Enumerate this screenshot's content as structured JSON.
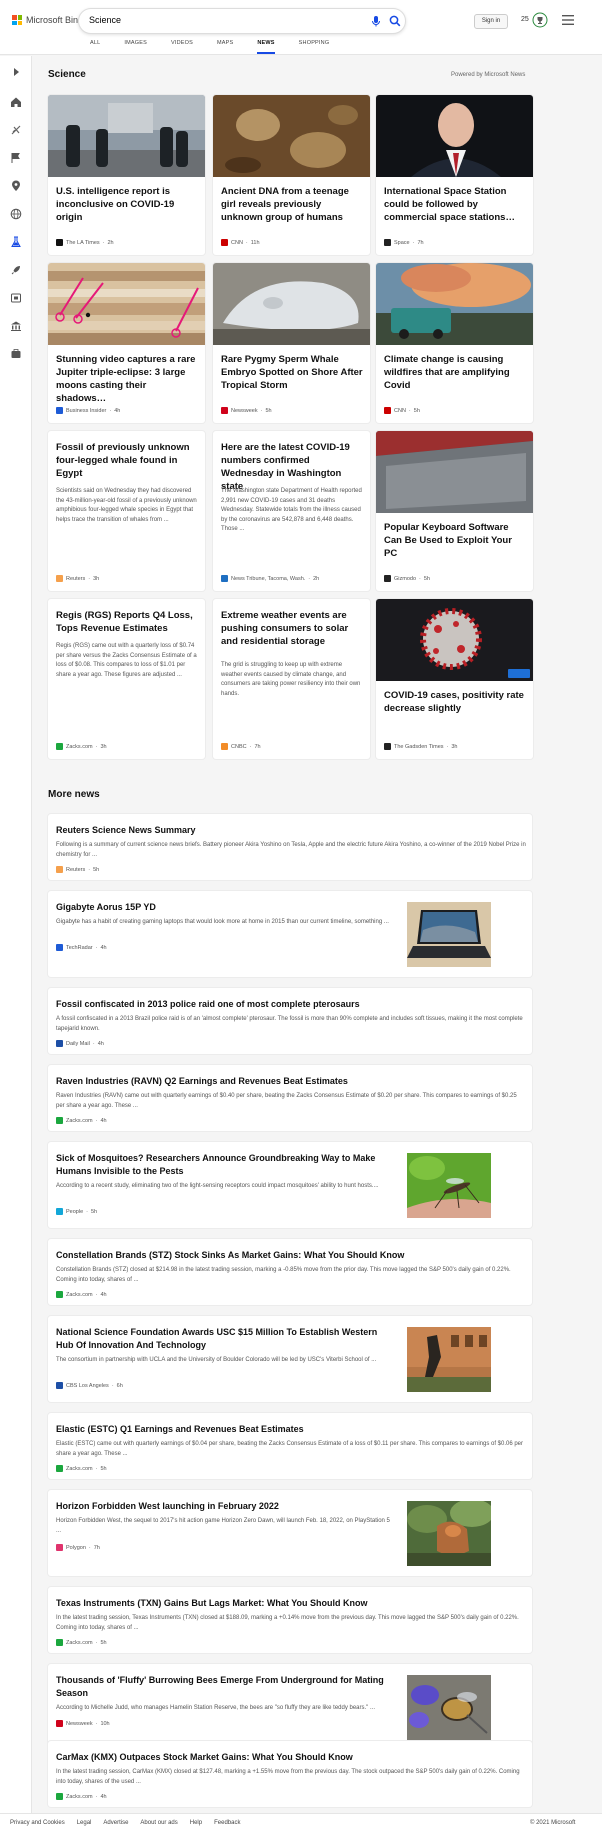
{
  "brand": {
    "name": "Microsoft Bing"
  },
  "search": {
    "value": "Science"
  },
  "header": {
    "signin_label": "Sign in",
    "rewards_count": "25"
  },
  "tabs": [
    {
      "label": "ALL"
    },
    {
      "label": "IMAGES"
    },
    {
      "label": "VIDEOS"
    },
    {
      "label": "MAPS"
    },
    {
      "label": "NEWS"
    },
    {
      "label": "SHOPPING"
    }
  ],
  "rail_icons": [
    "expand-icon",
    "home-icon",
    "sports-icon",
    "flag-icon",
    "location-icon",
    "globe-icon",
    "science-icon",
    "rocket-icon",
    "entertainment-icon",
    "money-icon",
    "health-icon"
  ],
  "section": {
    "title": "Science",
    "powered_by": "Powered by Microsoft News"
  },
  "cards": [
    {
      "title": "U.S. intelligence report is inconclusive on COVID-19 origin",
      "source": "The LA Times",
      "time": "2h",
      "snippet": ""
    },
    {
      "title": "Ancient DNA from a teenage girl reveals previously unknown group of humans",
      "source": "CNN",
      "time": "11h",
      "snippet": ""
    },
    {
      "title": "International Space Station could be followed by commercial space stations…",
      "source": "Space",
      "time": "7h",
      "snippet": ""
    },
    {
      "title": "Stunning video captures a rare Jupiter triple-eclipse: 3 large moons casting their shadows…",
      "source": "Business Insider",
      "time": "4h",
      "snippet": ""
    },
    {
      "title": "Rare Pygmy Sperm Whale Embryo Spotted on Shore After Tropical Storm",
      "source": "Newsweek",
      "time": "5h",
      "snippet": ""
    },
    {
      "title": "Climate change is causing wildfires that are amplifying Covid",
      "source": "CNN",
      "time": "5h",
      "snippet": ""
    },
    {
      "title": "Fossil of previously unknown four-legged whale found in Egypt",
      "source": "Reuters",
      "time": "3h",
      "snippet": "Scientists said on Wednesday they had discovered the 43-million-year-old fossil of a previously unknown amphibious four-legged whale species in Egypt that helps trace the transition of whales from ..."
    },
    {
      "title": "Here are the latest COVID-19 numbers confirmed Wednesday in Washington state",
      "source": "News Tribune, Tacoma, Wash.",
      "time": "2h",
      "snippet": "The Washington state Department of Health reported 2,991 new COVID-19 cases and 31 deaths Wednesday. Statewide totals from the illness caused by the coronavirus are 542,878 and 6,448 deaths. Those ..."
    },
    {
      "title": "Popular Keyboard Software Can Be Used to Exploit Your PC",
      "source": "Gizmodo",
      "time": "5h",
      "snippet": ""
    },
    {
      "title": "Regis (RGS) Reports Q4 Loss, Tops Revenue Estimates",
      "source": "Zacks.com",
      "time": "3h",
      "snippet": "Regis (RGS) came out with a quarterly loss of $0.74 per share versus the Zacks Consensus Estimate of a loss of $0.08. This compares to loss of $1.01 per share a year ago. These figures are adjusted ..."
    },
    {
      "title": "Extreme weather events are pushing consumers to solar and residential storage",
      "source": "CNBC",
      "time": "7h",
      "snippet": "The grid is struggling to keep up with extreme weather events caused by climate change, and consumers are taking power resiliency into their own hands."
    },
    {
      "title": "COVID-19 cases, positivity rate decrease slightly",
      "source": "The Gadsden Times",
      "time": "3h",
      "snippet": ""
    }
  ],
  "more_news": {
    "title": "More news",
    "items": [
      {
        "title": "Reuters Science News Summary",
        "snippet": "Following is a summary of current science news briefs. Battery pioneer Akira Yoshino on Tesla, Apple and the electric future Akira Yoshino, a co-winner of the 2019 Nobel Prize in chemistry for ...",
        "source": "Reuters",
        "time": "5h"
      },
      {
        "title": "Gigabyte Aorus 15P YD",
        "snippet": "Gigabyte has a habit of creating gaming laptops that would look more at home in 2015 than our current timeline, something ...",
        "source": "TechRadar",
        "time": "4h"
      },
      {
        "title": "Fossil confiscated in 2013 police raid one of most complete pterosaurs",
        "snippet": "A fossil confiscated in a 2013 Brazil police raid is of an 'almost complete' pterosaur. The fossil is more than 90% complete and includes soft tissues, making it the most complete tapejarid known.",
        "source": "Daily Mail",
        "time": "4h"
      },
      {
        "title": "Raven Industries (RAVN) Q2 Earnings and Revenues Beat Estimates",
        "snippet": "Raven Industries (RAVN) came out with quarterly earnings of $0.40 per share, beating the Zacks Consensus Estimate of $0.20 per share. This compares to earnings of $0.25 per share a year ago. These ...",
        "source": "Zacks.com",
        "time": "4h"
      },
      {
        "title": "Sick of Mosquitoes? Researchers Announce Groundbreaking Way to Make Humans Invisible to the Pests",
        "snippet": "According to a recent study, eliminating two of the light-sensing receptors could impact mosquitoes' ability to hunt hosts....",
        "source": "People",
        "time": "5h"
      },
      {
        "title": "Constellation Brands (STZ) Stock Sinks As Market Gains: What You Should Know",
        "snippet": "Constellation Brands (STZ) closed at $214.98 in the latest trading session, marking a -0.85% move from the prior day. This move lagged the S&P 500's daily gain of 0.22%. Coming into today, shares of ...",
        "source": "Zacks.com",
        "time": "4h"
      },
      {
        "title": "National Science Foundation Awards USC $15 Million To Establish Western Hub Of Innovation And Technology",
        "snippet": "The consortium in partnership with UCLA and the University of Boulder Colorado will be led by USC's Viterbi School of ...",
        "source": "CBS Los Angeles",
        "time": "6h"
      },
      {
        "title": "Elastic (ESTC) Q1 Earnings and Revenues Beat Estimates",
        "snippet": "Elastic (ESTC) came out with quarterly earnings of $0.04 per share, beating the Zacks Consensus Estimate of a loss of $0.11 per share. This compares to earnings of $0.06 per share a year ago. These ...",
        "source": "Zacks.com",
        "time": "5h"
      },
      {
        "title": "Horizon Forbidden West launching in February 2022",
        "snippet": "Horizon Forbidden West, the sequel to 2017's hit action game Horizon Zero Dawn, will launch Feb. 18, 2022, on PlayStation 5 ...",
        "source": "Polygon",
        "time": "7h"
      },
      {
        "title": "Texas Instruments (TXN) Gains But Lags Market: What You Should Know",
        "snippet": "In the latest trading session, Texas Instruments (TXN) closed at $188.09, marking a +0.14% move from the previous day. This move lagged the S&P 500's daily gain of 0.22%. Coming into today, shares of ...",
        "source": "Zacks.com",
        "time": "5h"
      },
      {
        "title": "Thousands of 'Fluffy' Burrowing Bees Emerge From Underground for Mating Season",
        "snippet": "According to Michelle Judd, who manages Hamelin Station Reserve, the bees are \"so fluffy they are like teddy bears.\" ...",
        "source": "Newsweek",
        "time": "10h"
      },
      {
        "title": "CarMax (KMX) Outpaces Stock Market Gains: What You Should Know",
        "snippet": "In the latest trading session, CarMax (KMX) closed at $127.48, marking a +1.55% move from the previous day. The stock outpaced the S&P 500's daily gain of 0.22%. Coming into today, shares of the used ...",
        "source": "Zacks.com",
        "time": "4h"
      }
    ]
  },
  "footer": {
    "links": [
      "Privacy and Cookies",
      "Legal",
      "Advertise",
      "About our ads",
      "Help",
      "Feedback"
    ],
    "copyright": "© 2021 Microsoft"
  },
  "colors": {
    "accent": "#174ae4",
    "zacks": "#1ba73e",
    "cnn": "#cc0000",
    "newsweek": "#d0021b"
  }
}
